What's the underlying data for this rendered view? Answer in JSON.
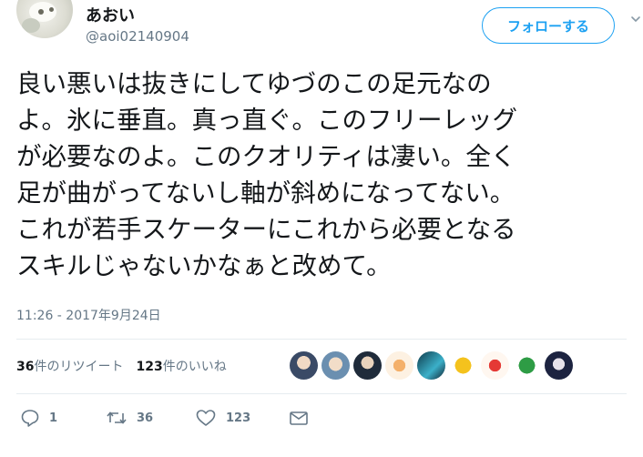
{
  "user": {
    "display_name": "あおい",
    "screen_name": "@aoi02140904"
  },
  "follow_button_label": "フォローする",
  "tweet_lines": [
    "良い悪いは抜きにしてゆづのこの足元なの",
    "よ。氷に垂直。真っ直ぐ。このフリーレッグ",
    "が必要なのよ。このクオリティは凄い。全く",
    "足が曲がってないし軸が斜めになってない。",
    "これが若手スケーターにこれから必要となる",
    "スキルじゃないかなぁと改めて。"
  ],
  "timestamp": "11:26 - 2017年9月24日",
  "stats": {
    "retweets_count": "36",
    "retweets_label": "件のリツイート",
    "likes_count": "123",
    "likes_label": "件のいいね"
  },
  "actions": {
    "reply_count": "1",
    "retweet_count": "36",
    "like_count": "123"
  },
  "icons": [
    "caret-down-icon",
    "reply-icon",
    "retweet-icon",
    "heart-icon",
    "message-icon"
  ],
  "colors": {
    "accent": "#1da1f2",
    "muted": "#657786",
    "text": "#14171a",
    "divider": "#e6ecf0"
  }
}
